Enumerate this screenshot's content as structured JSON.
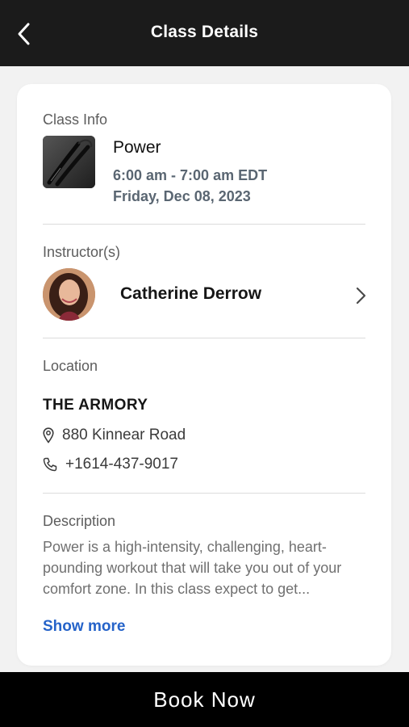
{
  "header": {
    "title": "Class Details",
    "back_icon": "back-chevron-icon"
  },
  "class_info": {
    "label": "Class Info",
    "name": "Power",
    "time": "6:00 am - 7:00 am EDT",
    "date": "Friday, Dec 08, 2023",
    "image_icon": "jump-rope-image"
  },
  "instructors": {
    "label": "Instructor(s)",
    "items": [
      {
        "name": "Catherine Derrow",
        "avatar": "instructor-avatar"
      }
    ]
  },
  "location": {
    "label": "Location",
    "name": "THE ARMORY",
    "address": "880 Kinnear Road",
    "phone": "+1614-437-9017"
  },
  "description": {
    "label": "Description",
    "text": "Power is a high-intensity, challenging, heart-pounding workout that will take you out of your comfort zone. In this class expect to get...",
    "show_more": "Show more"
  },
  "footer": {
    "book_label": "Book Now"
  },
  "colors": {
    "header_bg": "#1b1b1b",
    "link": "#2563c9",
    "meta": "#5a6672",
    "footer_bg": "#000000"
  }
}
